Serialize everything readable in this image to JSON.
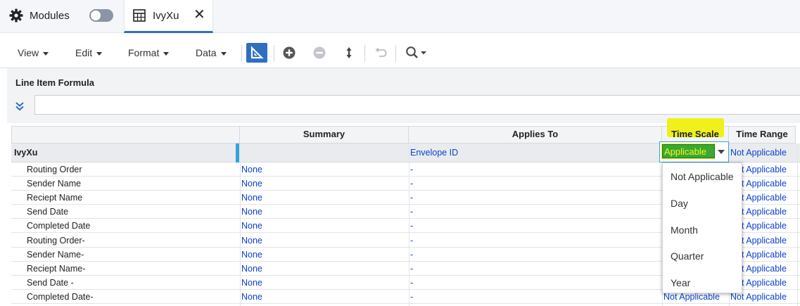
{
  "tabs": {
    "modules_label": "Modules",
    "active_label": "IvyXu",
    "close_glyph": "✕"
  },
  "toolbar": {
    "menus": [
      "View",
      "Edit",
      "Format",
      "Data"
    ]
  },
  "formula_bar": {
    "title": "Line Item Formula",
    "value": ""
  },
  "grid": {
    "headers": {
      "summary": "Summary",
      "applies_to": "Applies To",
      "time_scale": "Time Scale",
      "time_range": "Time Range"
    },
    "module_row": {
      "name": "IvyXu",
      "applies_to": "Envelope ID",
      "time_scale": "Applicable",
      "time_range": "Not Applicable"
    },
    "rows": [
      {
        "name": "Routing Order",
        "summary": "None",
        "applies_to": "-",
        "time_range": "Not Applicable"
      },
      {
        "name": "Sender Name",
        "summary": "None",
        "applies_to": "-",
        "time_range": "Not Applicable"
      },
      {
        "name": "Reciept Name",
        "summary": "None",
        "applies_to": "-",
        "time_range": "Not Applicable"
      },
      {
        "name": "Send Date",
        "summary": "None",
        "applies_to": "-",
        "time_range": "Not Applicable"
      },
      {
        "name": "Completed Date",
        "summary": "None",
        "applies_to": "-",
        "time_range": "Not Applicable"
      },
      {
        "name": "Routing Order-",
        "summary": "None",
        "applies_to": "-",
        "time_range": "Not Applicable"
      },
      {
        "name": "Sender Name-",
        "summary": "None",
        "applies_to": "-",
        "time_range": "Not Applicable"
      },
      {
        "name": "Reciept Name-",
        "summary": "None",
        "applies_to": "-",
        "time_range": "Not Applicable"
      },
      {
        "name": "Send Date -",
        "summary": "None",
        "applies_to": "-",
        "time_range": "Not Applicable"
      },
      {
        "name": "Completed Date-",
        "summary": "None",
        "applies_to": "-",
        "time_scale": "Not Applicable",
        "time_range": "Not Applicable"
      }
    ]
  },
  "dropdown": {
    "options": [
      "Not Applicable",
      "Day",
      "Month",
      "Quarter",
      "Year"
    ]
  },
  "colors": {
    "accent": "#2f6fc2",
    "link_text": "#0b3fd0",
    "highlight": "#f0f01a",
    "selection_green": "#3aa832"
  }
}
